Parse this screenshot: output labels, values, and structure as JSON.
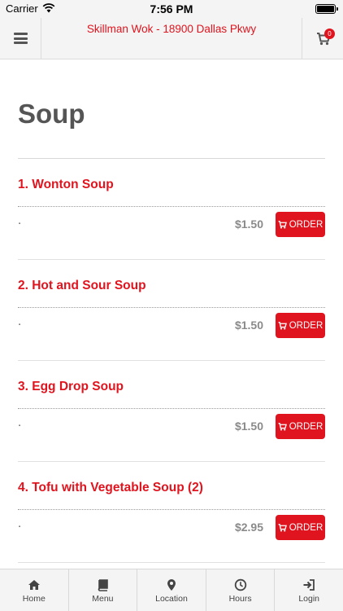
{
  "status_bar": {
    "carrier": "Carrier",
    "time": "7:56 PM"
  },
  "header": {
    "title": "Skillman Wok - 18900 Dallas Pkwy",
    "cart_count": "0"
  },
  "section": {
    "title": "Soup"
  },
  "items": [
    {
      "name": "1. Wonton Soup",
      "description": ".",
      "price": "$1.50",
      "order_label": "ORDER"
    },
    {
      "name": "2. Hot and Sour Soup",
      "description": ".",
      "price": "$1.50",
      "order_label": "ORDER"
    },
    {
      "name": "3. Egg Drop Soup",
      "description": ".",
      "price": "$1.50",
      "order_label": "ORDER"
    },
    {
      "name": "4. Tofu with Vegetable Soup (2)",
      "description": ".",
      "price": "$2.95",
      "order_label": "ORDER"
    }
  ],
  "tabs": [
    {
      "label": "Home",
      "icon": "home-icon"
    },
    {
      "label": "Menu",
      "icon": "book-icon"
    },
    {
      "label": "Location",
      "icon": "map-pin-icon"
    },
    {
      "label": "Hours",
      "icon": "clock-icon"
    },
    {
      "label": "Login",
      "icon": "sign-in-icon"
    }
  ],
  "colors": {
    "accent": "#e0141e",
    "heading": "#555555",
    "price": "#8a8a8a",
    "bar": "#f4f4f4"
  }
}
